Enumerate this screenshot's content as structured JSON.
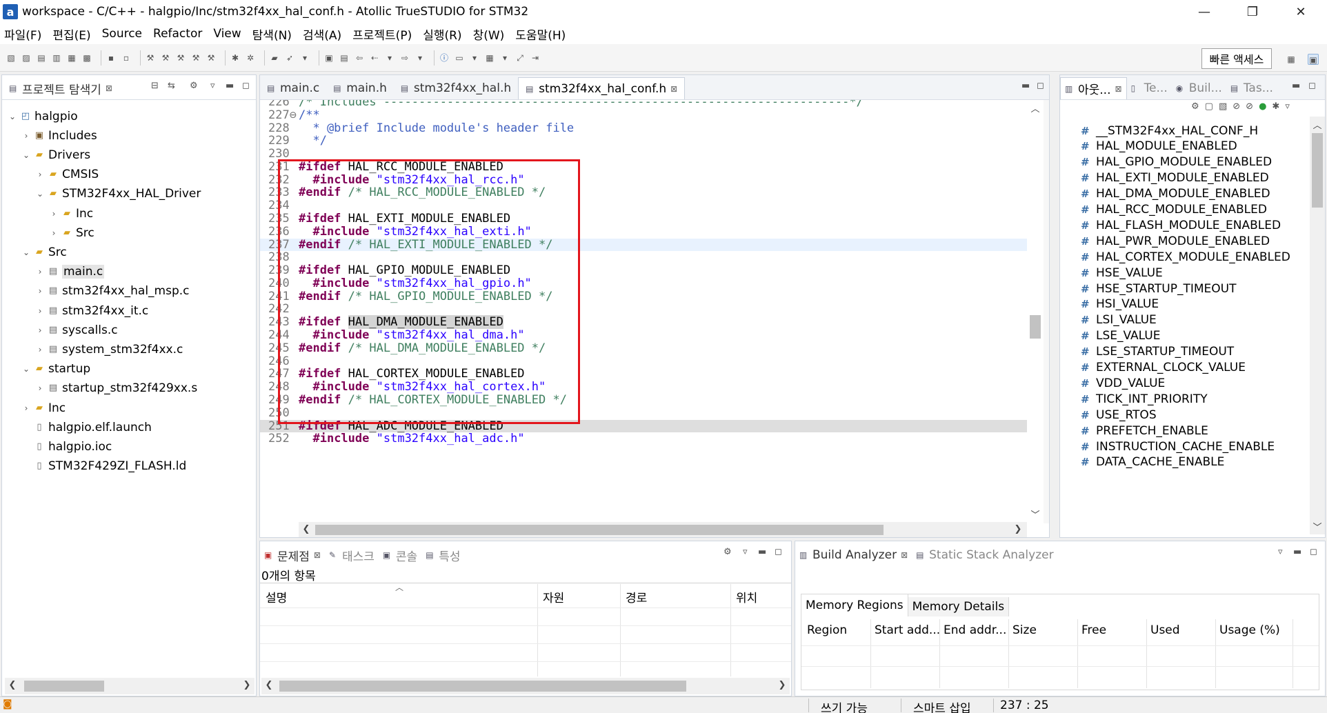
{
  "window": {
    "title": "workspace - C/C++ - halgpio/Inc/stm32f4xx_hal_conf.h - Atollic TrueSTUDIO for STM32",
    "logo_letter": "a",
    "minimize": "—",
    "restore": "❐",
    "close": "✕"
  },
  "menu": [
    {
      "label": "파일(F)"
    },
    {
      "label": "편집(E)"
    },
    {
      "label": "Source"
    },
    {
      "label": "Refactor"
    },
    {
      "label": "View"
    },
    {
      "label": "탐색(N)"
    },
    {
      "label": "검색(A)"
    },
    {
      "label": "프로젝트(P)"
    },
    {
      "label": "실행(R)"
    },
    {
      "label": "창(W)"
    },
    {
      "label": "도움말(H)"
    }
  ],
  "toolbar": {
    "quick_access": "빠른 액세스"
  },
  "project_explorer": {
    "tab_label": "프로젝트 탐색기",
    "tree": [
      {
        "label": "halgpio",
        "depth": 0,
        "arrow": "⌄",
        "icon": "project-icon",
        "glyph": "◰"
      },
      {
        "label": "Includes",
        "depth": 1,
        "arrow": "›",
        "icon": "includes-icon",
        "glyph": "▣"
      },
      {
        "label": "Drivers",
        "depth": 1,
        "arrow": "⌄",
        "icon": "folder-icon",
        "glyph": "▰"
      },
      {
        "label": "CMSIS",
        "depth": 2,
        "arrow": "›",
        "icon": "folder-icon",
        "glyph": "▰"
      },
      {
        "label": "STM32F4xx_HAL_Driver",
        "depth": 2,
        "arrow": "⌄",
        "icon": "folder-icon",
        "glyph": "▰"
      },
      {
        "label": "Inc",
        "depth": 3,
        "arrow": "›",
        "icon": "folder-icon",
        "glyph": "▰"
      },
      {
        "label": "Src",
        "depth": 3,
        "arrow": "›",
        "icon": "folder-icon",
        "glyph": "▰"
      },
      {
        "label": "Src",
        "depth": 1,
        "arrow": "⌄",
        "icon": "folder-icon",
        "glyph": "▰"
      },
      {
        "label": "main.c",
        "depth": 2,
        "arrow": "›",
        "icon": "c-file-icon",
        "glyph": "▤",
        "selected": true
      },
      {
        "label": "stm32f4xx_hal_msp.c",
        "depth": 2,
        "arrow": "›",
        "icon": "c-file-icon",
        "glyph": "▤"
      },
      {
        "label": "stm32f4xx_it.c",
        "depth": 2,
        "arrow": "›",
        "icon": "c-file-icon",
        "glyph": "▤"
      },
      {
        "label": "syscalls.c",
        "depth": 2,
        "arrow": "›",
        "icon": "c-file-icon",
        "glyph": "▤"
      },
      {
        "label": "system_stm32f4xx.c",
        "depth": 2,
        "arrow": "›",
        "icon": "c-file-icon",
        "glyph": "▤"
      },
      {
        "label": "startup",
        "depth": 1,
        "arrow": "⌄",
        "icon": "folder-icon",
        "glyph": "▰"
      },
      {
        "label": "startup_stm32f429xx.s",
        "depth": 2,
        "arrow": "›",
        "icon": "asm-file-icon",
        "glyph": "▤"
      },
      {
        "label": "Inc",
        "depth": 1,
        "arrow": "›",
        "icon": "folder-icon",
        "glyph": "▰"
      },
      {
        "label": "halgpio.elf.launch",
        "depth": 1,
        "arrow": "",
        "icon": "file-icon",
        "glyph": "▯"
      },
      {
        "label": "halgpio.ioc",
        "depth": 1,
        "arrow": "",
        "icon": "file-icon",
        "glyph": "▯"
      },
      {
        "label": "STM32F429ZI_FLASH.ld",
        "depth": 1,
        "arrow": "",
        "icon": "file-icon",
        "glyph": "▯"
      }
    ]
  },
  "editor": {
    "tabs": [
      {
        "label": "main.c"
      },
      {
        "label": "main.h"
      },
      {
        "label": "stm32f4xx_hal.h"
      },
      {
        "label": "stm32f4xx_hal_conf.h",
        "active": true
      }
    ],
    "lines": [
      {
        "n": "226",
        "parts": [
          {
            "c": "cm",
            "t": "/* Includes ------------------------------------------------------------------*/"
          }
        ]
      },
      {
        "n": "227⊖",
        "parts": [
          {
            "c": "cmb",
            "t": "/**"
          }
        ]
      },
      {
        "n": "228",
        "parts": [
          {
            "c": "cmb",
            "t": "  * @brief Include module's header file"
          }
        ]
      },
      {
        "n": "229",
        "parts": [
          {
            "c": "cmb",
            "t": "  */"
          }
        ]
      },
      {
        "n": "230",
        "parts": []
      },
      {
        "n": "231",
        "parts": [
          {
            "c": "kw",
            "t": "#ifdef"
          },
          {
            "c": "",
            "t": " HAL_RCC_MODULE_ENABLED"
          }
        ]
      },
      {
        "n": "232",
        "parts": [
          {
            "c": "",
            "t": "  "
          },
          {
            "c": "kw",
            "t": "#include"
          },
          {
            "c": "",
            "t": " "
          },
          {
            "c": "str",
            "t": "\"stm32f4xx_hal_rcc.h\""
          }
        ]
      },
      {
        "n": "233",
        "parts": [
          {
            "c": "kw",
            "t": "#endif"
          },
          {
            "c": "",
            "t": " "
          },
          {
            "c": "cm",
            "t": "/* HAL_RCC_MODULE_ENABLED */"
          }
        ]
      },
      {
        "n": "234",
        "parts": []
      },
      {
        "n": "235",
        "parts": [
          {
            "c": "kw",
            "t": "#ifdef"
          },
          {
            "c": "",
            "t": " HAL_EXTI_MODULE_ENABLED"
          }
        ]
      },
      {
        "n": "236",
        "parts": [
          {
            "c": "",
            "t": "  "
          },
          {
            "c": "kw",
            "t": "#include"
          },
          {
            "c": "",
            "t": " "
          },
          {
            "c": "str",
            "t": "\"stm32f4xx_hal_exti.h\""
          }
        ]
      },
      {
        "n": "237",
        "cur": true,
        "parts": [
          {
            "c": "kw",
            "t": "#endif"
          },
          {
            "c": "",
            "t": " "
          },
          {
            "c": "cm",
            "t": "/* HAL_EXTI_MODULE_ENABLED */"
          }
        ]
      },
      {
        "n": "238",
        "parts": []
      },
      {
        "n": "239",
        "parts": [
          {
            "c": "kw",
            "t": "#ifdef"
          },
          {
            "c": "",
            "t": " HAL_GPIO_MODULE_ENABLED"
          }
        ]
      },
      {
        "n": "240",
        "parts": [
          {
            "c": "",
            "t": "  "
          },
          {
            "c": "kw",
            "t": "#include"
          },
          {
            "c": "",
            "t": " "
          },
          {
            "c": "str",
            "t": "\"stm32f4xx_hal_gpio.h\""
          }
        ]
      },
      {
        "n": "241",
        "parts": [
          {
            "c": "kw",
            "t": "#endif"
          },
          {
            "c": "",
            "t": " "
          },
          {
            "c": "cm",
            "t": "/* HAL_GPIO_MODULE_ENABLED */"
          }
        ]
      },
      {
        "n": "242",
        "parts": []
      },
      {
        "n": "243",
        "parts": [
          {
            "c": "kw",
            "t": "#ifdef"
          },
          {
            "c": "",
            "t": " "
          },
          {
            "c": "sel",
            "t": "HAL_DMA_MODULE_ENABLED"
          }
        ]
      },
      {
        "n": "244",
        "parts": [
          {
            "c": "",
            "t": "  "
          },
          {
            "c": "kw",
            "t": "#include"
          },
          {
            "c": "",
            "t": " "
          },
          {
            "c": "str",
            "t": "\"stm32f4xx_hal_dma.h\""
          }
        ]
      },
      {
        "n": "245",
        "parts": [
          {
            "c": "kw",
            "t": "#endif"
          },
          {
            "c": "",
            "t": " "
          },
          {
            "c": "cm",
            "t": "/* HAL_DMA_MODULE_ENABLED */"
          }
        ]
      },
      {
        "n": "246",
        "parts": []
      },
      {
        "n": "247",
        "parts": [
          {
            "c": "kw",
            "t": "#ifdef"
          },
          {
            "c": "",
            "t": " HAL_CORTEX_MODULE_ENABLED"
          }
        ]
      },
      {
        "n": "248",
        "parts": [
          {
            "c": "",
            "t": "  "
          },
          {
            "c": "kw",
            "t": "#include"
          },
          {
            "c": "",
            "t": " "
          },
          {
            "c": "str",
            "t": "\"stm32f4xx_hal_cortex.h\""
          }
        ]
      },
      {
        "n": "249",
        "parts": [
          {
            "c": "kw",
            "t": "#endif"
          },
          {
            "c": "",
            "t": " "
          },
          {
            "c": "cm",
            "t": "/* HAL_CORTEX_MODULE_ENABLED */"
          }
        ]
      },
      {
        "n": "250",
        "parts": []
      },
      {
        "n": "251",
        "hl": true,
        "parts": [
          {
            "c": "kw",
            "t": "#ifdef"
          },
          {
            "c": "",
            "t": " HAL_ADC_MODULE_ENABLED"
          }
        ]
      },
      {
        "n": "252",
        "parts": [
          {
            "c": "",
            "t": "  "
          },
          {
            "c": "kw",
            "t": "#include"
          },
          {
            "c": "",
            "t": " "
          },
          {
            "c": "str",
            "t": "\"stm32f4xx_hal_adc.h\""
          }
        ]
      }
    ]
  },
  "outline": {
    "tabs": [
      {
        "label": "아웃...",
        "active": true
      },
      {
        "label": "Te..."
      },
      {
        "label": "Buil..."
      },
      {
        "label": "Tas..."
      }
    ],
    "items": [
      "__STM32F4xx_HAL_CONF_H",
      "HAL_MODULE_ENABLED",
      "HAL_GPIO_MODULE_ENABLED",
      "HAL_EXTI_MODULE_ENABLED",
      "HAL_DMA_MODULE_ENABLED",
      "HAL_RCC_MODULE_ENABLED",
      "HAL_FLASH_MODULE_ENABLED",
      "HAL_PWR_MODULE_ENABLED",
      "HAL_CORTEX_MODULE_ENABLED",
      "HSE_VALUE",
      "HSE_STARTUP_TIMEOUT",
      "HSI_VALUE",
      "LSI_VALUE",
      "LSE_VALUE",
      "LSE_STARTUP_TIMEOUT",
      "EXTERNAL_CLOCK_VALUE",
      "VDD_VALUE",
      "TICK_INT_PRIORITY",
      "USE_RTOS",
      "PREFETCH_ENABLE",
      "INSTRUCTION_CACHE_ENABLE",
      "DATA_CACHE_ENABLE"
    ]
  },
  "problems": {
    "tabs": [
      {
        "label": "문제점",
        "active": true
      },
      {
        "label": "태스크"
      },
      {
        "label": "콘솔"
      },
      {
        "label": "특성"
      }
    ],
    "count_text": "0개의 항목",
    "columns": [
      "설명",
      "자원",
      "경로",
      "위치"
    ]
  },
  "build_analyzer": {
    "tabs": [
      {
        "label": "Build Analyzer",
        "active": true
      },
      {
        "label": "Static Stack Analyzer"
      }
    ],
    "subtabs": [
      {
        "label": "Memory Regions",
        "active": true
      },
      {
        "label": "Memory Details"
      }
    ],
    "columns": [
      "Region",
      "Start add...",
      "End addr...",
      "Size",
      "Free",
      "Used",
      "Usage (%)"
    ]
  },
  "status": {
    "writable": "쓰기 가능",
    "insert_mode": "스마트 삽입",
    "position": "237 : 25"
  }
}
